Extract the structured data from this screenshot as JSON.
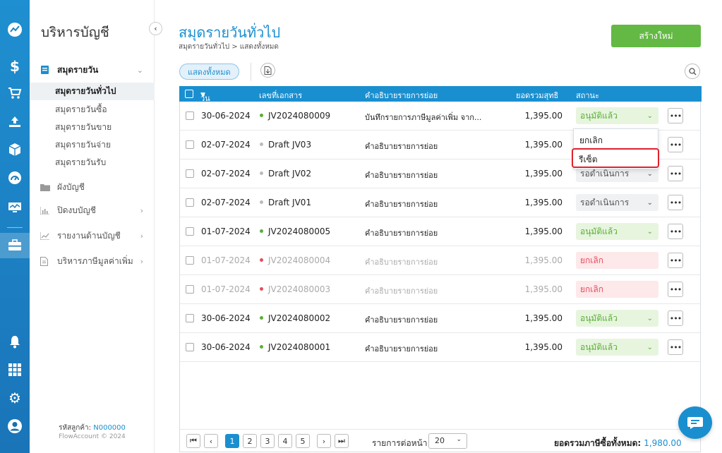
{
  "sidebar": {
    "title": "บริหารบัญชี",
    "menus": [
      {
        "label": "สมุดรายวัน"
      },
      {
        "label": "ผังบัญชี"
      },
      {
        "label": "ปิดงบบัญชี"
      },
      {
        "label": "รายงานด้านบัญชี"
      },
      {
        "label": "บริหารภาษีมูลค่าเพิ่ม"
      }
    ],
    "journal_items": [
      {
        "label": "สมุดรายวันทั่วไป"
      },
      {
        "label": "สมุดรายวันซื้อ"
      },
      {
        "label": "สมุดรายวันขาย"
      },
      {
        "label": "สมุดรายวันจ่าย"
      },
      {
        "label": "สมุดรายวันรับ"
      }
    ],
    "customer_label": "รหัสลูกค้า:",
    "customer_id": "N000000",
    "copyright": "FlowAccount © 2024"
  },
  "page": {
    "title": "สมุดรายวันทั่วไป",
    "breadcrumb": "สมุดรายวันทั่วไป > แสดงทั้งหมด",
    "create_button": "สร้างใหม่",
    "filter_all": "แสดงทั้งหมด"
  },
  "table": {
    "headers": {
      "date": "วันที่",
      "docno": "เลขที่เอกสาร",
      "desc": "คำอธิบายรายการย่อย",
      "total": "ยอดรวมสุทธิ",
      "status": "สถานะ"
    },
    "rows": [
      {
        "date": "30-06-2024",
        "docno": "JV2024080009",
        "desc": "บันทึกรายการภาษีมูลค่าเพิ่ม จาก...",
        "amount": "1,395.00",
        "status": "อนุมัติแล้ว",
        "kind": "approved"
      },
      {
        "date": "02-07-2024",
        "docno": "Draft JV03",
        "desc": "คำอธิบายรายการย่อย",
        "amount": "1,395.00",
        "status": "",
        "kind": "draft"
      },
      {
        "date": "02-07-2024",
        "docno": "Draft JV02",
        "desc": "คำอธิบายรายการย่อย",
        "amount": "1,395.00",
        "status": "รอดำเนินการ",
        "kind": "draft"
      },
      {
        "date": "02-07-2024",
        "docno": "Draft JV01",
        "desc": "คำอธิบายรายการย่อย",
        "amount": "1,395.00",
        "status": "รอดำเนินการ",
        "kind": "draft"
      },
      {
        "date": "01-07-2024",
        "docno": "JV2024080005",
        "desc": "คำอธิบายรายการย่อย",
        "amount": "1,395.00",
        "status": "อนุมัติแล้ว",
        "kind": "approved"
      },
      {
        "date": "01-07-2024",
        "docno": "JV2024080004",
        "desc": "คำอธิบายรายการย่อย",
        "amount": "1,395.00",
        "status": "ยกเลิก",
        "kind": "cancelled"
      },
      {
        "date": "01-07-2024",
        "docno": "JV2024080003",
        "desc": "คำอธิบายรายการย่อย",
        "amount": "1,395.00",
        "status": "ยกเลิก",
        "kind": "cancelled"
      },
      {
        "date": "30-06-2024",
        "docno": "JV2024080002",
        "desc": "คำอธิบายรายการย่อย",
        "amount": "1,395.00",
        "status": "อนุมัติแล้ว",
        "kind": "approved"
      },
      {
        "date": "30-06-2024",
        "docno": "JV2024080001",
        "desc": "คำอธิบายรายการย่อย",
        "amount": "1,395.00",
        "status": "อนุมัติแล้ว",
        "kind": "approved"
      }
    ]
  },
  "dropdown": {
    "options": [
      "ยกเลิก",
      "รีเซ็ต"
    ],
    "highlighted": "รีเซ็ต"
  },
  "pagination": {
    "pages": [
      "1",
      "2",
      "3",
      "4",
      "5"
    ],
    "current_page": "1",
    "per_page_label": "รายการต่อหน้า",
    "per_page_value": "20",
    "total_label": "ยอดรวมภาษีซื้อทั้งหมด:",
    "total_value": "1,980.00"
  },
  "colors": {
    "primary": "#1a8fd0",
    "approved": "#5aae35",
    "cancelled": "#e74c5b",
    "create": "#63b944",
    "highlight": "#e0202e"
  },
  "icons": [
    "chart-icon",
    "dollar-icon",
    "cart-icon",
    "upload-icon",
    "box-icon",
    "gauge-icon",
    "monitor-icon",
    "briefcase-icon",
    "bell-icon",
    "apps-grid-icon",
    "gear-icon",
    "user-icon",
    "chat-icon"
  ]
}
